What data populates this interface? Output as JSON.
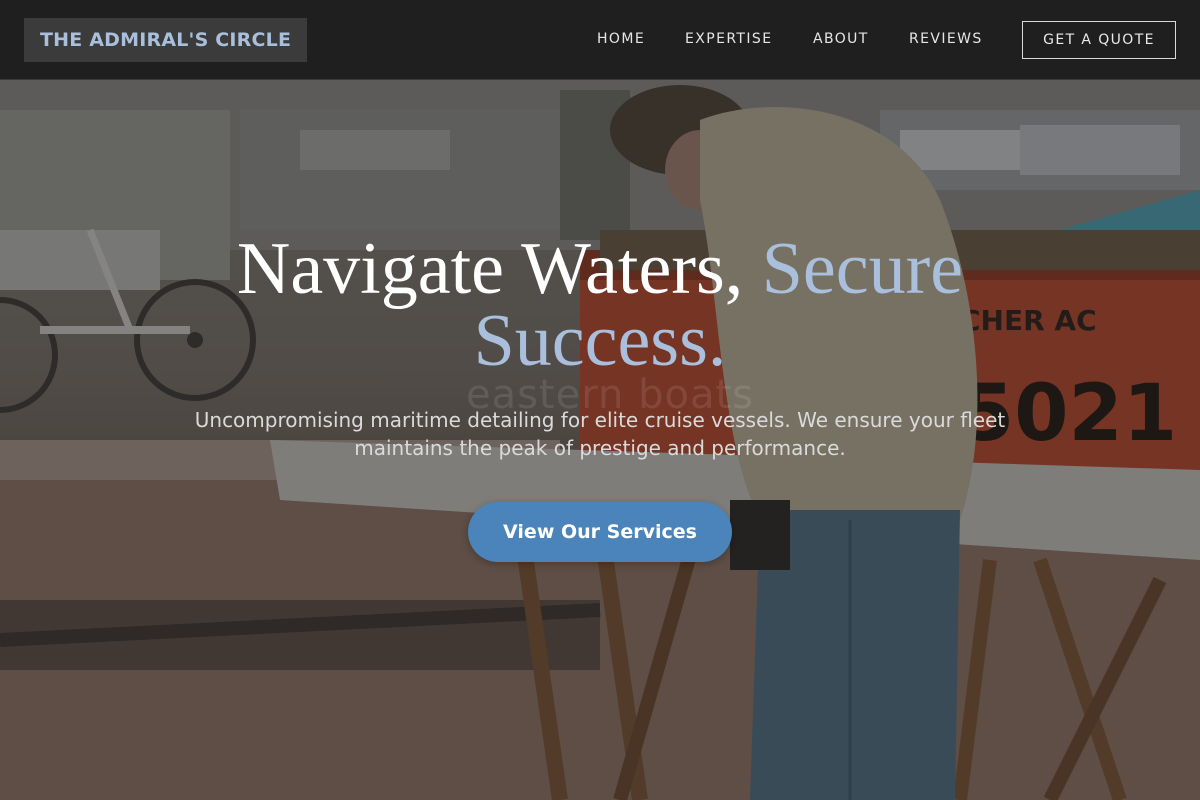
{
  "brand": {
    "name": "THE ADMIRAL'S CIRCLE",
    "color": "#a9bfdc"
  },
  "nav": {
    "links": [
      {
        "label": "HOME"
      },
      {
        "label": "EXPERTISE"
      },
      {
        "label": "ABOUT"
      },
      {
        "label": "REVIEWS"
      }
    ],
    "cta_label": "GET A QUOTE"
  },
  "hero": {
    "headline_part1": "Navigate Waters, ",
    "headline_accent": "Secure Success.",
    "subtitle": "Uncompromising maritime detailing for elite cruise vessels. We ensure your fleet maintains the peak of prestige and performance.",
    "watermark": "eastern boats",
    "cta_label": "View Our Services",
    "background_image": "marina-worker-sanding-photo",
    "accent_color": "#a9bfdc",
    "cta_color": "#4a84bb"
  }
}
